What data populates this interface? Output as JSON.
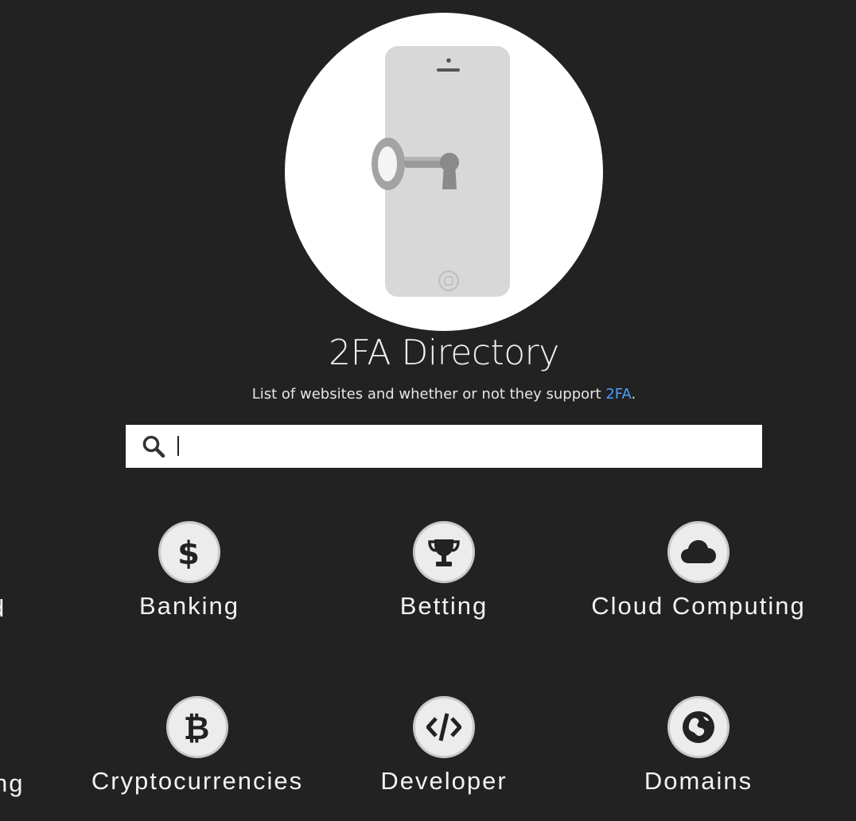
{
  "header": {
    "title": "2FA Directory",
    "subtitle_prefix": "List of websites and whether or not they support ",
    "subtitle_link": "2FA",
    "subtitle_suffix": "."
  },
  "search": {
    "placeholder": "",
    "value": ""
  },
  "categories": [
    {
      "label": "Banking",
      "icon": "dollar-icon"
    },
    {
      "label": "Betting",
      "icon": "trophy-icon"
    },
    {
      "label": "Cloud Computing",
      "icon": "cloud-icon"
    },
    {
      "label": "Cryptocurrencies",
      "icon": "bitcoin-icon"
    },
    {
      "label": "Developer",
      "icon": "code-icon"
    },
    {
      "label": "Domains",
      "icon": "globe-icon"
    }
  ],
  "partial_categories": {
    "row1_left": "d",
    "row2_left": "ng"
  },
  "colors": {
    "background": "#222222",
    "link": "#4d9fff",
    "badge": "#ececec",
    "icon": "#222222"
  }
}
